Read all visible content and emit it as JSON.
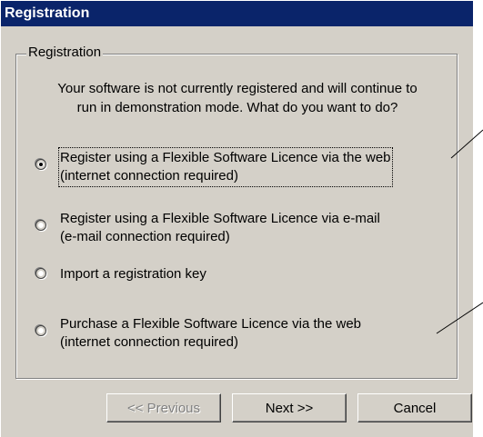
{
  "window": {
    "title": "Registration"
  },
  "group": {
    "legend": "Registration",
    "intro_line1": "Your software is not currently registered and will continue to",
    "intro_line2": "run in demonstration mode.  What do you want to do?"
  },
  "options": [
    {
      "line1": "Register using a Flexible Software Licence via the web",
      "line2": "(internet connection required)",
      "selected": true
    },
    {
      "line1": "Register using a Flexible Software Licence via e-mail",
      "line2": "(e-mail connection required)",
      "selected": false
    },
    {
      "line1": "Import a registration key",
      "line2": "",
      "selected": false
    },
    {
      "line1": "Purchase a Flexible Software Licence via the web",
      "line2": "(internet connection required)",
      "selected": false
    }
  ],
  "buttons": {
    "previous": "<< Previous",
    "next": "Next >>",
    "cancel": "Cancel"
  },
  "colors": {
    "titlebar": "#0a246a",
    "dialog_face": "#d4d0c8"
  }
}
